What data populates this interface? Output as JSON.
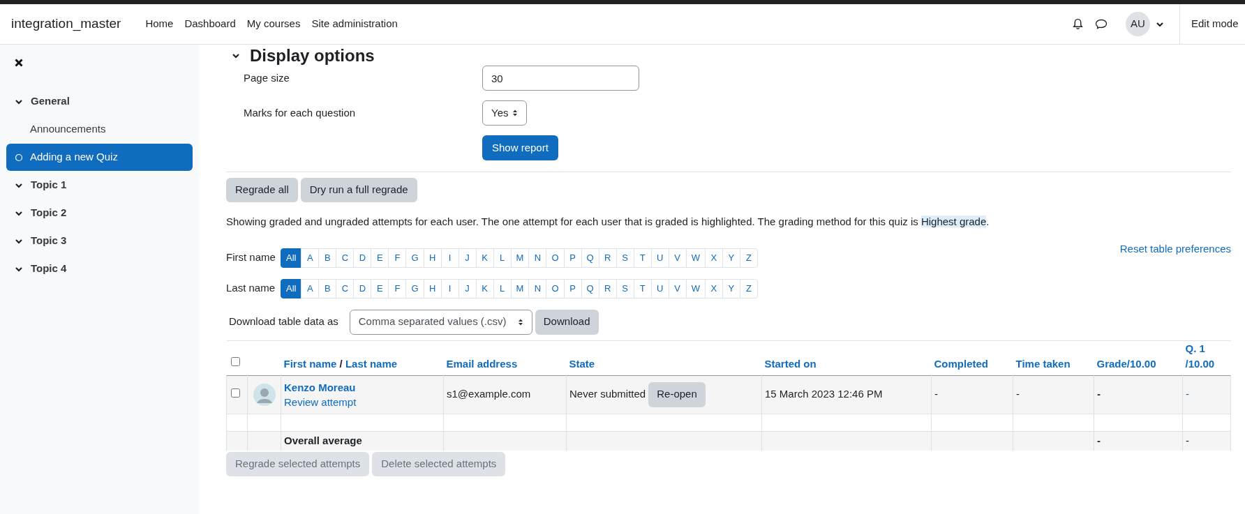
{
  "navbar": {
    "site_name": "integration_master",
    "links": [
      "Home",
      "Dashboard",
      "My courses",
      "Site administration"
    ],
    "user_initials": "AU",
    "edit_mode_label": "Edit mode"
  },
  "sidebar": {
    "items": [
      {
        "kind": "section",
        "label": "General",
        "expanded": true,
        "selected": false
      },
      {
        "kind": "activity",
        "label": "Announcements",
        "selected": false
      },
      {
        "kind": "activity",
        "label": "Adding a new Quiz",
        "selected": true
      },
      {
        "kind": "section",
        "label": "Topic 1",
        "expanded": true,
        "selected": false
      },
      {
        "kind": "section",
        "label": "Topic 2",
        "expanded": true,
        "selected": false
      },
      {
        "kind": "section",
        "label": "Topic 3",
        "expanded": true,
        "selected": false
      },
      {
        "kind": "section",
        "label": "Topic 4",
        "expanded": true,
        "selected": false
      }
    ]
  },
  "display_options": {
    "heading": "Display options",
    "page_size": {
      "label": "Page size",
      "value": "30"
    },
    "marks": {
      "label": "Marks for each question",
      "value": "Yes"
    },
    "show_report": "Show report"
  },
  "regrade_buttons": [
    "Regrade all",
    "Dry run a full regrade"
  ],
  "info": {
    "text": "Showing graded and ungraded attempts for each user. The one attempt for each user that is graded is highlighted. The grading method for this quiz is ",
    "highlight": "Highest grade",
    "end": "."
  },
  "reset_link": "Reset table preferences",
  "initials_filters": [
    {
      "label": "First name",
      "letters": [
        {
          "label": "All",
          "selected": true
        },
        {
          "label": "A",
          "selected": false
        },
        {
          "label": "B",
          "selected": false
        },
        {
          "label": "C",
          "selected": false
        },
        {
          "label": "D",
          "selected": false
        },
        {
          "label": "E",
          "selected": false
        },
        {
          "label": "F",
          "selected": false
        },
        {
          "label": "G",
          "selected": false
        },
        {
          "label": "H",
          "selected": false
        },
        {
          "label": "I",
          "selected": false
        },
        {
          "label": "J",
          "selected": false
        },
        {
          "label": "K",
          "selected": false
        },
        {
          "label": "L",
          "selected": false
        },
        {
          "label": "M",
          "selected": false
        },
        {
          "label": "N",
          "selected": false
        },
        {
          "label": "O",
          "selected": false
        },
        {
          "label": "P",
          "selected": false
        },
        {
          "label": "Q",
          "selected": false
        },
        {
          "label": "R",
          "selected": false
        },
        {
          "label": "S",
          "selected": false
        },
        {
          "label": "T",
          "selected": false
        },
        {
          "label": "U",
          "selected": false
        },
        {
          "label": "V",
          "selected": false
        },
        {
          "label": "W",
          "selected": false
        },
        {
          "label": "X",
          "selected": false
        },
        {
          "label": "Y",
          "selected": false
        },
        {
          "label": "Z",
          "selected": false
        }
      ]
    },
    {
      "label": "Last name",
      "letters": [
        {
          "label": "All",
          "selected": true
        },
        {
          "label": "A",
          "selected": false
        },
        {
          "label": "B",
          "selected": false
        },
        {
          "label": "C",
          "selected": false
        },
        {
          "label": "D",
          "selected": false
        },
        {
          "label": "E",
          "selected": false
        },
        {
          "label": "F",
          "selected": false
        },
        {
          "label": "G",
          "selected": false
        },
        {
          "label": "H",
          "selected": false
        },
        {
          "label": "I",
          "selected": false
        },
        {
          "label": "J",
          "selected": false
        },
        {
          "label": "K",
          "selected": false
        },
        {
          "label": "L",
          "selected": false
        },
        {
          "label": "M",
          "selected": false
        },
        {
          "label": "N",
          "selected": false
        },
        {
          "label": "O",
          "selected": false
        },
        {
          "label": "P",
          "selected": false
        },
        {
          "label": "Q",
          "selected": false
        },
        {
          "label": "R",
          "selected": false
        },
        {
          "label": "S",
          "selected": false
        },
        {
          "label": "T",
          "selected": false
        },
        {
          "label": "U",
          "selected": false
        },
        {
          "label": "V",
          "selected": false
        },
        {
          "label": "W",
          "selected": false
        },
        {
          "label": "X",
          "selected": false
        },
        {
          "label": "Y",
          "selected": false
        },
        {
          "label": "Z",
          "selected": false
        }
      ]
    }
  ],
  "download": {
    "label": "Download table data as",
    "format": "Comma separated values (.csv)",
    "button": "Download"
  },
  "table": {
    "select_all_checked": false,
    "columns": [
      {
        "kind": "name",
        "first": "First name",
        "separator": "/",
        "last": "Last name"
      },
      {
        "kind": "text",
        "label": "Email address"
      },
      {
        "kind": "text",
        "label": "State"
      },
      {
        "kind": "text",
        "label": "Started on"
      },
      {
        "kind": "text",
        "label": "Completed"
      },
      {
        "kind": "text",
        "label": "Time taken"
      },
      {
        "kind": "text",
        "label": "Grade/10.00"
      },
      {
        "kind": "text",
        "label": "Q. 1 /10.00"
      }
    ],
    "rows": [
      {
        "kind": "attempt",
        "checked": false,
        "name": "Kenzo Moreau",
        "review": "Review attempt",
        "email": "s1@example.com",
        "state": "Never submitted",
        "action": "Re-open",
        "started": "15 March 2023 12:46 PM",
        "completed": "-",
        "time_taken": "-",
        "grade": "-",
        "q1": "-"
      },
      {
        "kind": "spacer"
      },
      {
        "kind": "average",
        "label": "Overall average",
        "grade": "-",
        "q1": "-"
      }
    ]
  },
  "bulk_buttons": [
    {
      "label": "Regrade selected attempts",
      "disabled": true
    },
    {
      "label": "Delete selected attempts",
      "disabled": true
    }
  ]
}
